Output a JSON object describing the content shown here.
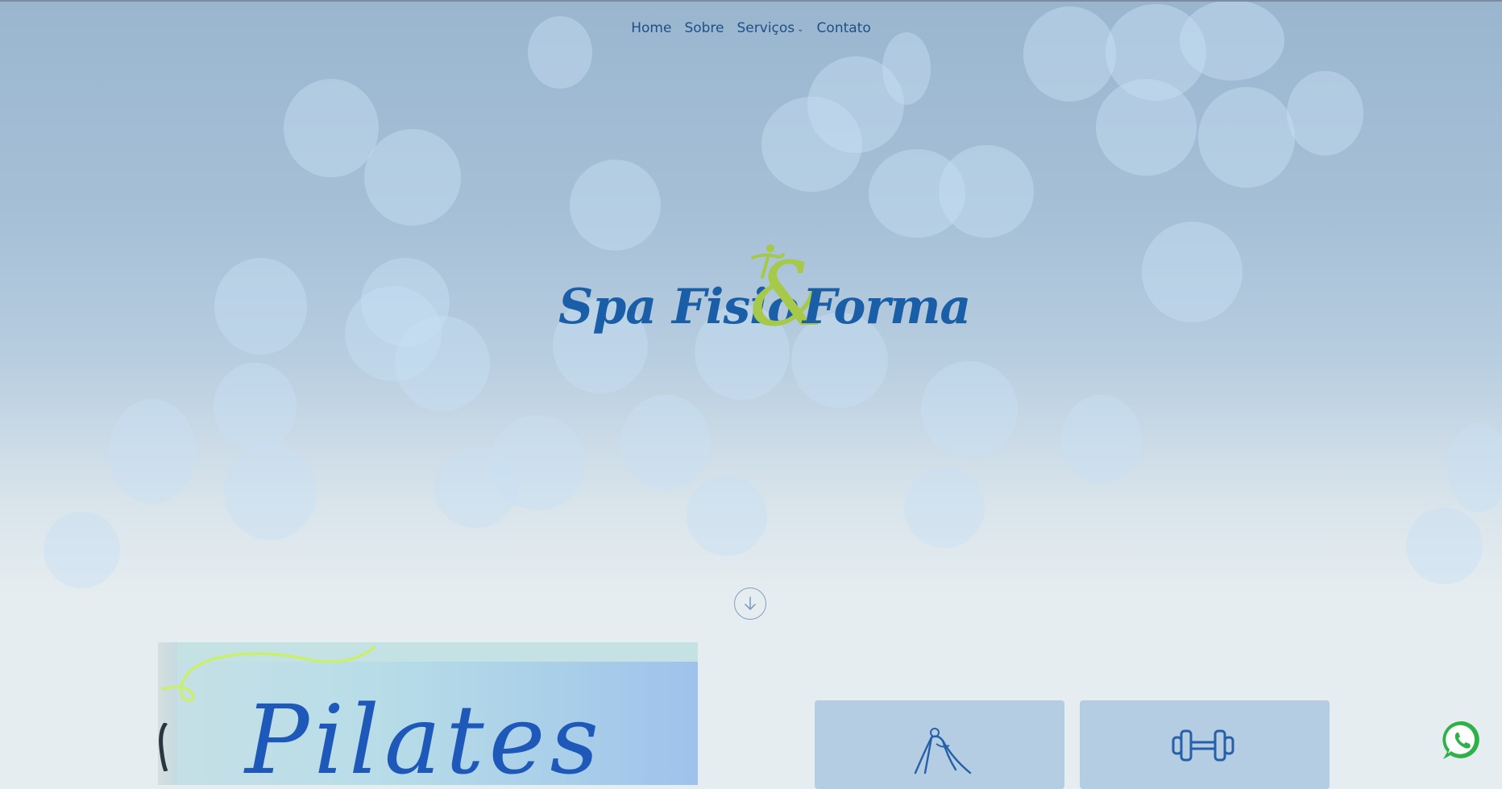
{
  "nav": {
    "items": [
      "Home",
      "Sobre",
      "Serviços",
      "Contato"
    ],
    "services_chevron": "⌄"
  },
  "logo": {
    "part1": "Spa Fisio",
    "amp": "&",
    "part2": "Forma"
  },
  "promo": {
    "title": "Pilates"
  },
  "colors": {
    "nav_text": "#1f4f86",
    "logo_blue": "#1a5ea8",
    "logo_green": "#a7c94a",
    "card_bg": "#b5cde2",
    "whatsapp_green": "#2fb14a"
  },
  "icons": {
    "scroll": "arrow-down-circle-icon",
    "card1": "yoga-pose-icon",
    "card2": "dumbbell-icon",
    "chat": "whatsapp-icon"
  }
}
